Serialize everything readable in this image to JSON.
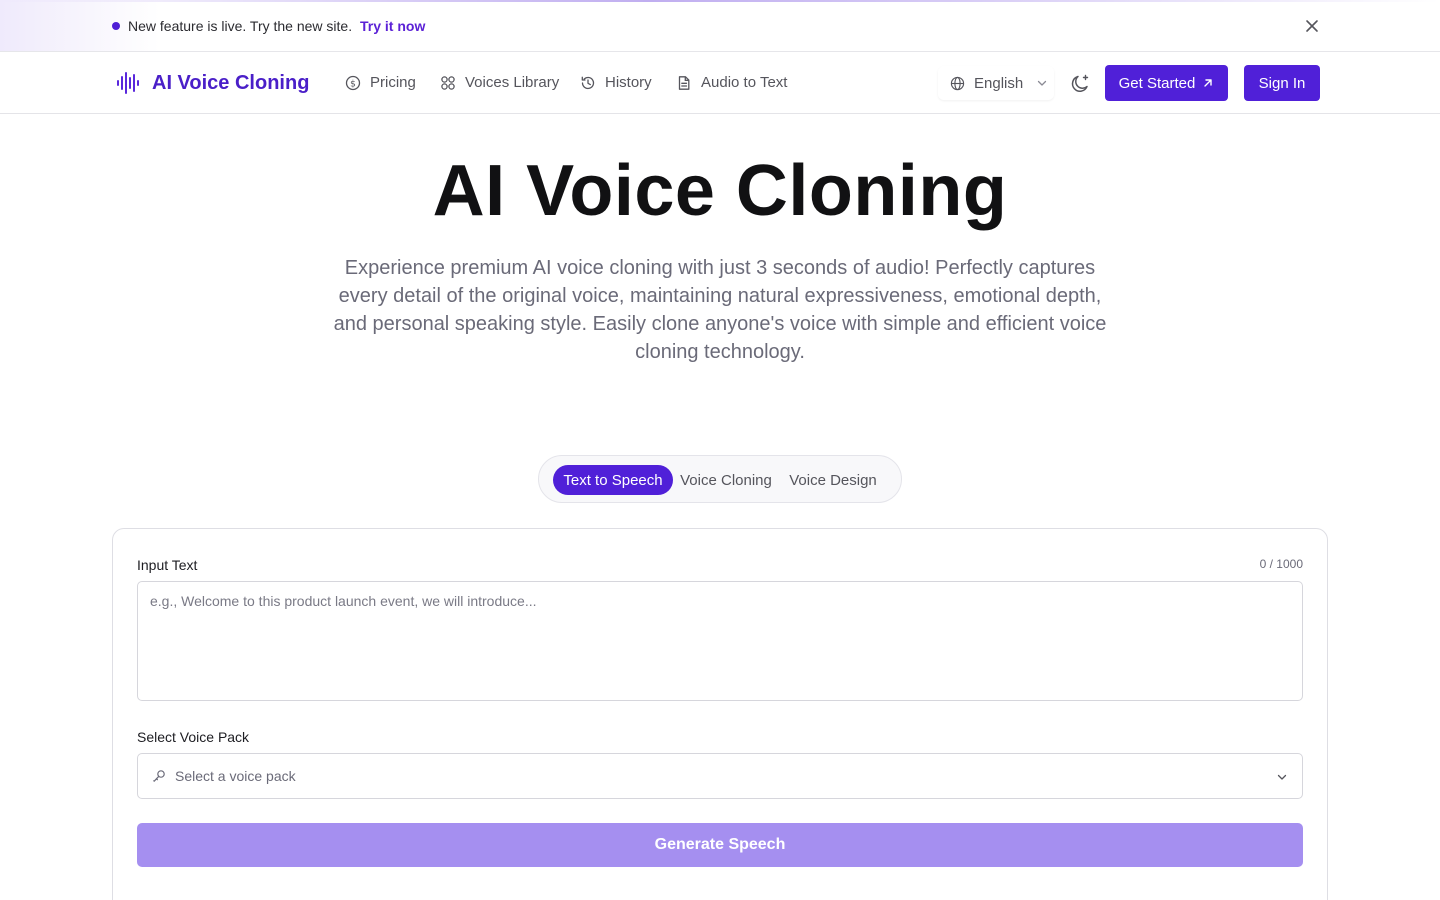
{
  "banner": {
    "text": "New feature is live. Try the new site.",
    "link": "Try it now"
  },
  "nav": {
    "logo": "AI Voice Cloning",
    "items": [
      {
        "label": "Pricing",
        "icon": "dollar-circle-icon"
      },
      {
        "label": "Voices Library",
        "icon": "grid-icon"
      },
      {
        "label": "History",
        "icon": "history-icon"
      },
      {
        "label": "Audio to Text",
        "icon": "document-icon"
      }
    ],
    "language": "English",
    "get_started": "Get Started",
    "sign_in": "Sign In"
  },
  "hero": {
    "title": "AI Voice Cloning",
    "subtitle": "Experience premium AI voice cloning with just 3 seconds of audio! Perfectly captures every detail of the original voice, maintaining natural expressiveness, emotional depth, and personal speaking style. Easily clone anyone's voice with simple and efficient voice cloning technology."
  },
  "tabs": [
    {
      "label": "Text to Speech",
      "active": true
    },
    {
      "label": "Voice Cloning",
      "active": false
    },
    {
      "label": "Voice Design",
      "active": false
    }
  ],
  "form": {
    "input_label": "Input Text",
    "counter": "0 / 1000",
    "placeholder": "e.g., Welcome to this product launch event, we will introduce...",
    "value": "",
    "voice_label": "Select Voice Pack",
    "voice_placeholder": "Select a voice pack",
    "generate": "Generate Speech"
  },
  "colors": {
    "accent": "#5020d8",
    "logo": "#4a1fc8",
    "generate_disabled": "#a58ff0"
  }
}
